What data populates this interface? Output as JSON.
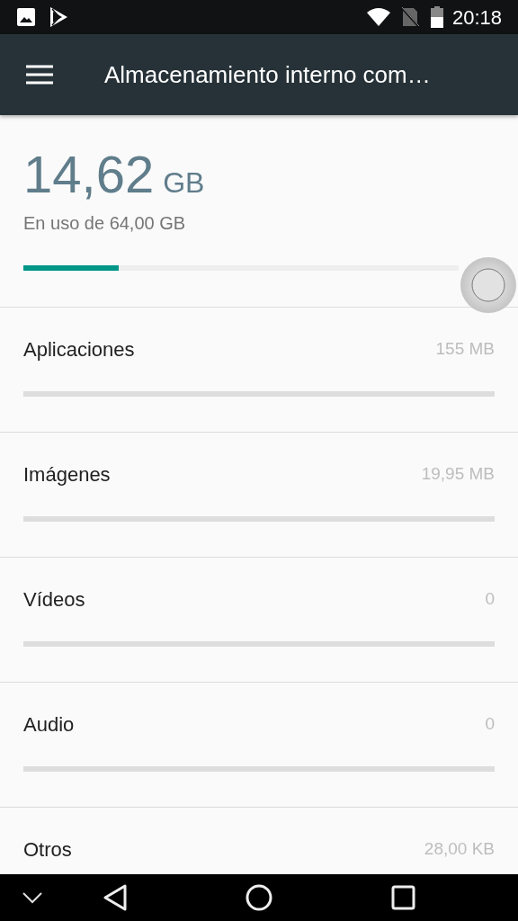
{
  "status_bar": {
    "time": "20:18"
  },
  "toolbar": {
    "title": "Almacenamiento interno com…"
  },
  "summary": {
    "used": "14,62",
    "unit": "GB",
    "caption": "En uso de 64,00 GB",
    "level": 0.22
  },
  "categories": [
    {
      "label": "Aplicaciones",
      "size": "155 MB"
    },
    {
      "label": "Imágenes",
      "size": "19,95 MB"
    },
    {
      "label": "Vídeos",
      "size": "0"
    },
    {
      "label": "Audio",
      "size": "0"
    },
    {
      "label": "Otros",
      "size": "28,00 KB"
    }
  ]
}
